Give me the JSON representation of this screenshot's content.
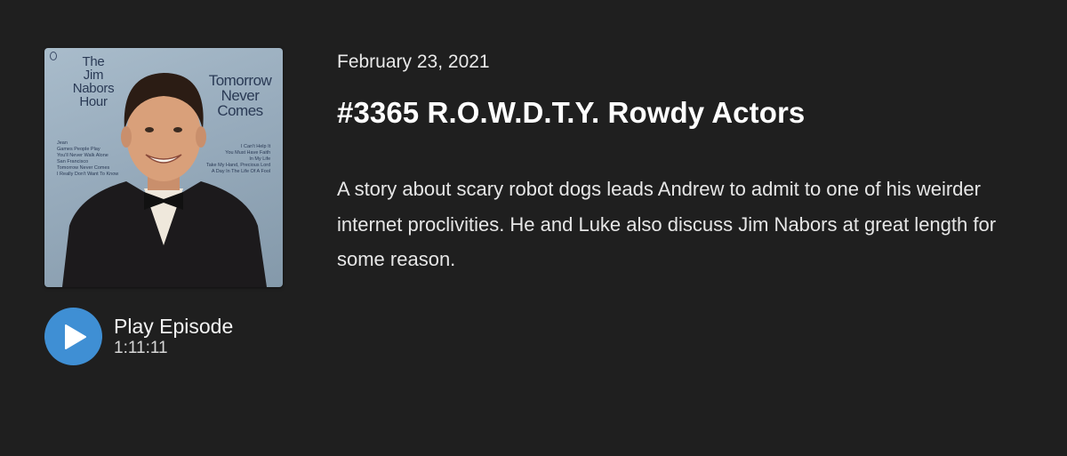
{
  "episode": {
    "date": "February 23, 2021",
    "title": "#3365 R.O.W.D.T.Y. Rowdy Actors",
    "description": "A story about scary robot dogs leads Andrew to admit to one of his weirder internet proclivities. He and Luke also discuss Jim Nabors at great length for some reason."
  },
  "artwork": {
    "title_left": "The\nJim\nNabors\nHour",
    "title_right": "Tomorrow\nNever\nComes",
    "tracks_left": "Jean\nGames People Play\nYou'll Never Walk Alone\nSan Francisco\nTomorrow Never Comes\nI Really Don't Want To Know",
    "tracks_right": "I Can't Help It\nYou Must Have Faith\nIn My Life\nTake My Hand, Precious Lord\nA Day In The Life Of A Fool"
  },
  "player": {
    "play_label": "Play Episode",
    "duration": "1:11:11",
    "play_icon": "play-triangle",
    "accent_color": "#3f8fd4"
  }
}
